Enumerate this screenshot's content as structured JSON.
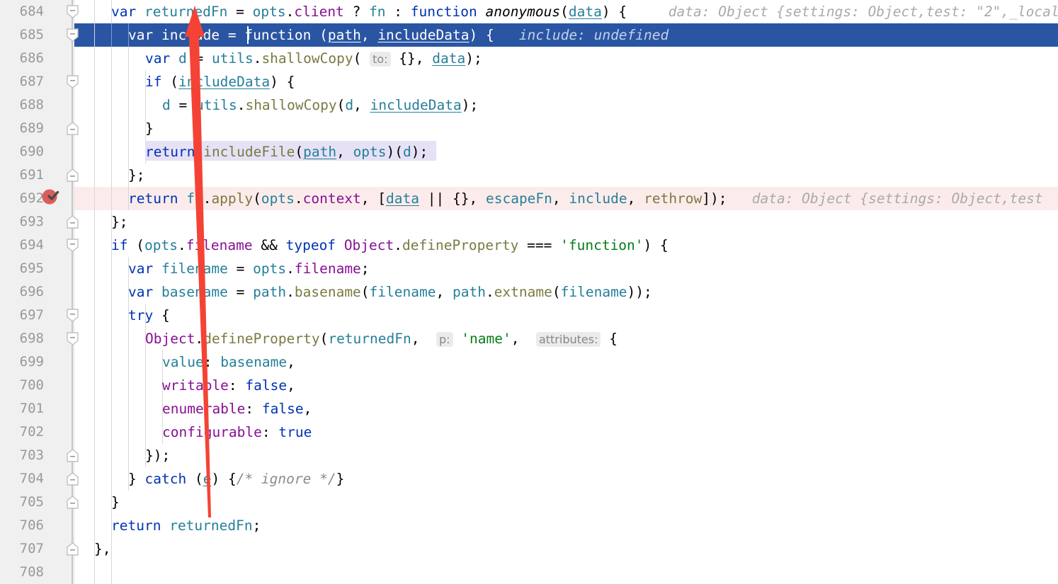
{
  "editor": {
    "app": "code-editor",
    "language": "javascript",
    "font_size_px": 19,
    "line_height_px": 33,
    "first_visible_line": 684,
    "last_visible_line": 708,
    "colors": {
      "background": "#ffffff",
      "gutter_background": "#f0f0f0",
      "line_number": "#999999",
      "execution_line": "#2a55a3",
      "execution_line_text": "#ffffff",
      "breakpoint_line": "#fbeceb",
      "current_line_gutter": "#fdf9e6",
      "usage_highlight": "#e6e1f5",
      "keyword": "#0033b3",
      "string": "#067d17",
      "property": "#871094",
      "function_name": "#7a7a43",
      "local_variable": "#267f99",
      "comment": "#8c8c8c",
      "inline_hint": "#aaaaaa",
      "parameter_hint_bg": "#ebebeb",
      "annotation_arrow": "#f44336"
    },
    "annotation": {
      "type": "arrow",
      "shape": "red-tapered-arrow",
      "points_to_line": 685,
      "points_to_token": "include",
      "tail_line": 705,
      "color": "#f44336"
    },
    "lines": [
      {
        "number": "684",
        "fold": "start",
        "text": "    var returnedFn = opts.client ? fn : function anonymous(data) {",
        "inline_hint": "data: Object {settings: Object,test: \"2\",_local",
        "state": "normal"
      },
      {
        "number": "685",
        "fold": "start",
        "text": "      var include = function (path, includeData) {",
        "inline_hint": "include: undefined",
        "state": "execution-point",
        "caret": true
      },
      {
        "number": "686",
        "fold": "none",
        "text": "        var d = utils.shallowCopy( to: {}, data);",
        "inline_hint": "",
        "state": "normal"
      },
      {
        "number": "687",
        "fold": "start",
        "text": "        if (includeData) {",
        "inline_hint": "",
        "state": "normal"
      },
      {
        "number": "688",
        "fold": "none",
        "text": "          d = utils.shallowCopy(d, includeData);",
        "inline_hint": "",
        "state": "normal"
      },
      {
        "number": "689",
        "fold": "end",
        "text": "        }",
        "inline_hint": "",
        "state": "normal"
      },
      {
        "number": "690",
        "fold": "none",
        "text": "        return includeFile(path, opts)(d);",
        "inline_hint": "",
        "state": "usage-highlight"
      },
      {
        "number": "691",
        "fold": "end",
        "text": "      };",
        "inline_hint": "",
        "state": "normal"
      },
      {
        "number": "692",
        "fold": "none",
        "breakpoint": "verified",
        "text": "      return fn.apply(opts.context, [data || {}, escapeFn, include, rethrow]);",
        "inline_hint": "data: Object {settings: Object,test",
        "state": "breakpoint-line"
      },
      {
        "number": "693",
        "fold": "end",
        "text": "    };",
        "inline_hint": "",
        "state": "normal"
      },
      {
        "number": "694",
        "fold": "start",
        "text": "    if (opts.filename && typeof Object.defineProperty === 'function') {",
        "inline_hint": "",
        "state": "normal"
      },
      {
        "number": "695",
        "fold": "none",
        "text": "      var filename = opts.filename;",
        "inline_hint": "",
        "state": "normal"
      },
      {
        "number": "696",
        "fold": "none",
        "text": "      var basename = path.basename(filename, path.extname(filename));",
        "inline_hint": "",
        "state": "normal"
      },
      {
        "number": "697",
        "fold": "start",
        "text": "      try {",
        "inline_hint": "",
        "state": "normal"
      },
      {
        "number": "698",
        "fold": "start",
        "text": "        Object.defineProperty(returnedFn,  p: 'name',  attributes: {",
        "inline_hint": "",
        "state": "normal"
      },
      {
        "number": "699",
        "fold": "none",
        "text": "          value: basename,",
        "inline_hint": "",
        "state": "normal"
      },
      {
        "number": "700",
        "fold": "none",
        "text": "          writable: false,",
        "inline_hint": "",
        "state": "normal"
      },
      {
        "number": "701",
        "fold": "none",
        "text": "          enumerable: false,",
        "inline_hint": "",
        "state": "normal"
      },
      {
        "number": "702",
        "fold": "none",
        "text": "          configurable: true",
        "inline_hint": "",
        "state": "normal"
      },
      {
        "number": "703",
        "fold": "end",
        "text": "        });",
        "inline_hint": "",
        "state": "normal"
      },
      {
        "number": "704",
        "fold": "end",
        "text": "      } catch (e) {/* ignore */}",
        "inline_hint": "",
        "state": "normal"
      },
      {
        "number": "705",
        "fold": "end",
        "text": "    }",
        "inline_hint": "",
        "state": "normal"
      },
      {
        "number": "706",
        "fold": "none",
        "text": "    return returnedFn;",
        "inline_hint": "",
        "state": "normal"
      },
      {
        "number": "707",
        "fold": "end",
        "text": "  },",
        "inline_hint": "",
        "state": "normal"
      },
      {
        "number": "708",
        "fold": "none",
        "text": "",
        "inline_hint": "",
        "state": "normal"
      }
    ]
  }
}
